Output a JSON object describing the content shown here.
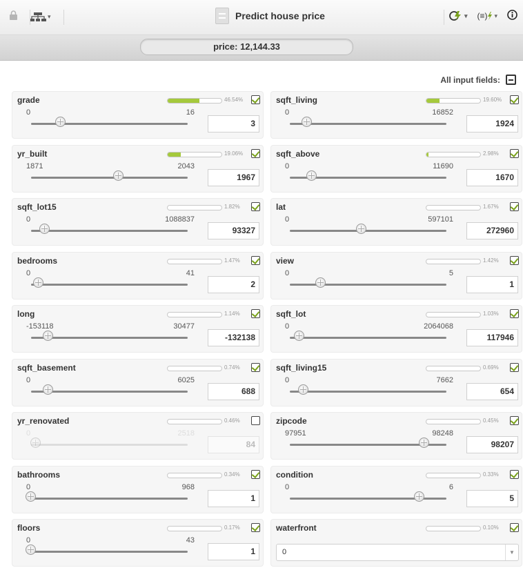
{
  "header": {
    "title": "Predict house price"
  },
  "prediction": {
    "text": "price: 12,144.33"
  },
  "controls": {
    "all_fields_label": "All input fields:"
  },
  "colors": {
    "accent": "#a5c93c",
    "info": "#5b8a12"
  },
  "fields": [
    {
      "name": "grade",
      "importance_text": "46.54%",
      "importance": 0.4654,
      "checked": true,
      "min": "0",
      "max": "16",
      "value": "3",
      "slider": 0.19
    },
    {
      "name": "sqft_living",
      "importance_text": "19.60%",
      "importance": 0.196,
      "checked": true,
      "min": "0",
      "max": "16852",
      "value": "1924",
      "slider": 0.11
    },
    {
      "name": "yr_built",
      "importance_text": "19.06%",
      "importance": 0.1906,
      "checked": true,
      "min": "1871",
      "max": "2043",
      "value": "1967",
      "slider": 0.56
    },
    {
      "name": "sqft_above",
      "importance_text": "2.98%",
      "importance": 0.0298,
      "checked": true,
      "min": "0",
      "max": "11690",
      "value": "1670",
      "slider": 0.14
    },
    {
      "name": "sqft_lot15",
      "importance_text": "1.82%",
      "importance": 0.0182,
      "checked": true,
      "min": "0",
      "max": "1088837",
      "value": "93327",
      "slider": 0.09
    },
    {
      "name": "lat",
      "importance_text": "1.67%",
      "importance": 0.0167,
      "checked": true,
      "min": "0",
      "max": "597101",
      "value": "272960",
      "slider": 0.46
    },
    {
      "name": "bedrooms",
      "importance_text": "1.47%",
      "importance": 0.0147,
      "checked": true,
      "min": "0",
      "max": "41",
      "value": "2",
      "slider": 0.05
    },
    {
      "name": "view",
      "importance_text": "1.42%",
      "importance": 0.0142,
      "checked": true,
      "min": "0",
      "max": "5",
      "value": "1",
      "slider": 0.2
    },
    {
      "name": "long",
      "importance_text": "1.14%",
      "importance": 0.0114,
      "checked": true,
      "min": "-153118",
      "max": "30477",
      "value": "-132138",
      "slider": 0.11
    },
    {
      "name": "sqft_lot",
      "importance_text": "1.03%",
      "importance": 0.0103,
      "checked": true,
      "min": "0",
      "max": "2064068",
      "value": "117946",
      "slider": 0.06
    },
    {
      "name": "sqft_basement",
      "importance_text": "0.74%",
      "importance": 0.0074,
      "checked": true,
      "min": "0",
      "max": "6025",
      "value": "688",
      "slider": 0.11
    },
    {
      "name": "sqft_living15",
      "importance_text": "0.69%",
      "importance": 0.0069,
      "checked": true,
      "min": "0",
      "max": "7662",
      "value": "654",
      "slider": 0.09
    },
    {
      "name": "yr_renovated",
      "importance_text": "0.46%",
      "importance": 0.0046,
      "checked": false,
      "min": "0",
      "max": "2518",
      "value": "84",
      "slider": 0.03
    },
    {
      "name": "zipcode",
      "importance_text": "0.45%",
      "importance": 0.0045,
      "checked": true,
      "min": "97951",
      "max": "98248",
      "value": "98207",
      "slider": 0.86
    },
    {
      "name": "bathrooms",
      "importance_text": "0.34%",
      "importance": 0.0034,
      "checked": true,
      "min": "0",
      "max": "968",
      "value": "1",
      "slider": 0.0
    },
    {
      "name": "condition",
      "importance_text": "0.33%",
      "importance": 0.0033,
      "checked": true,
      "min": "0",
      "max": "6",
      "value": "5",
      "slider": 0.83
    },
    {
      "name": "floors",
      "importance_text": "0.17%",
      "importance": 0.0017,
      "checked": true,
      "min": "0",
      "max": "43",
      "value": "1",
      "slider": 0.0
    },
    {
      "name": "waterfront",
      "importance_text": "0.10%",
      "importance": 0.001,
      "checked": true,
      "type": "select",
      "value": "0"
    }
  ]
}
